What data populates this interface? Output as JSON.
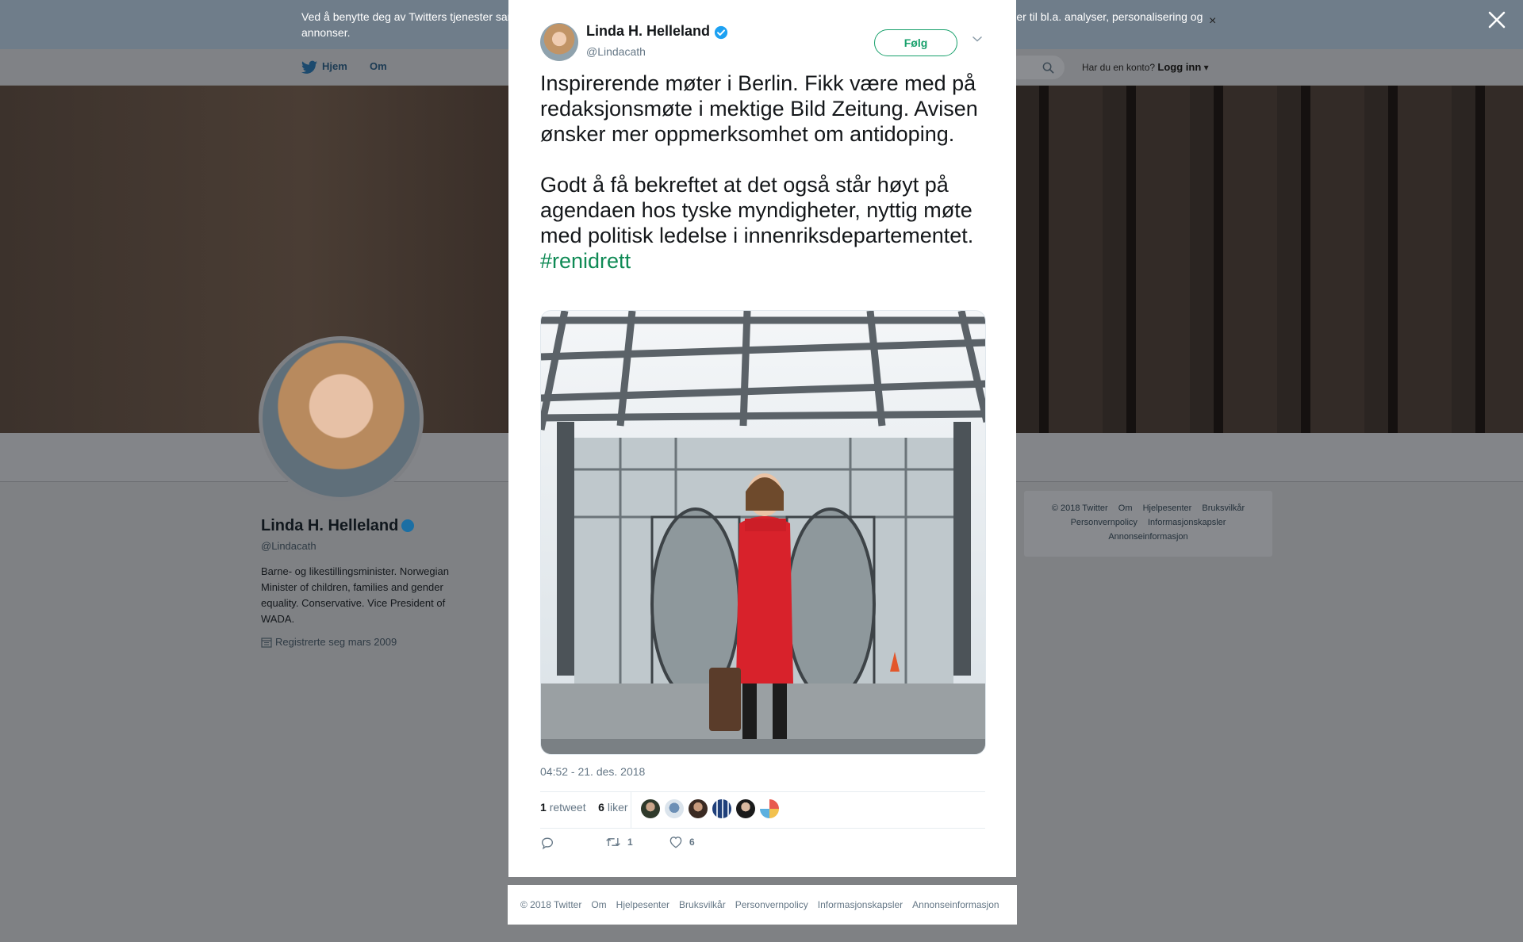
{
  "cookie_banner": {
    "text": "Ved å benytte deg av Twitters tjenester samtykker du til at vi bruker informasjonskapsler. Vi og våre samarbeidspartnere bruker informasjonskapsler til bl.a. analyser, personalisering og annonser.",
    "close_icon": "×"
  },
  "top_nav": {
    "home": "Hjem",
    "about": "Om",
    "account_prompt": "Har du en konto?",
    "login": "Logg inn"
  },
  "profile": {
    "name": "Linda H. Helleland",
    "handle": "@Lindacath",
    "bio": "Barne- og likestillingsminister. Norwegian Minister of children, families and gender equality. Conservative. Vice President of WADA.",
    "joined": "Registrerte seg mars 2009"
  },
  "side_footer": {
    "row1": [
      "© 2018 Twitter",
      "Om",
      "Hjelpesenter",
      "Bruksvilkår"
    ],
    "row2": [
      "Personvernpolicy",
      "Informasjonskapsler"
    ],
    "row3": [
      "Annonseinformasjon"
    ]
  },
  "tweet": {
    "author_name": "Linda H. Helleland",
    "author_handle": "@Lindacath",
    "follow_label": "Følg",
    "text": "Inspirerende møter i Berlin. Fikk være med på redaksjonsmøte i mektige Bild Zeitung. Avisen ønsker mer oppmerksomhet om antidoping.\n\nGodt å få bekreftet at det også står høyt på agendaen hos tyske myndigheter, nyttig møte med politisk ledelse i innenriksdepartementet. ",
    "hashtag": "#renidrett",
    "timestamp": "04:52 - 21. des. 2018",
    "retweet_count": "1",
    "retweet_label": "retweet",
    "like_count": "6",
    "like_label": "liker",
    "action_retweets": "1",
    "action_likes": "6"
  },
  "footer": {
    "links": [
      "© 2018 Twitter",
      "Om",
      "Hjelpesenter",
      "Bruksvilkår",
      "Personvernpolicy",
      "Informasjonskapsler",
      "Annonseinformasjon"
    ]
  },
  "icons": {
    "close": "close-icon",
    "verified": "verified-badge-icon",
    "twitter": "twitter-bird-icon",
    "search": "search-icon",
    "calendar": "calendar-icon",
    "reply": "reply-icon",
    "retweet": "retweet-icon",
    "like": "heart-icon",
    "caret": "chevron-down-icon"
  },
  "colors": {
    "accent": "#17a06b",
    "hashtag": "#0f8a55",
    "verified": "#1da1f2",
    "muted_text": "#657786"
  }
}
